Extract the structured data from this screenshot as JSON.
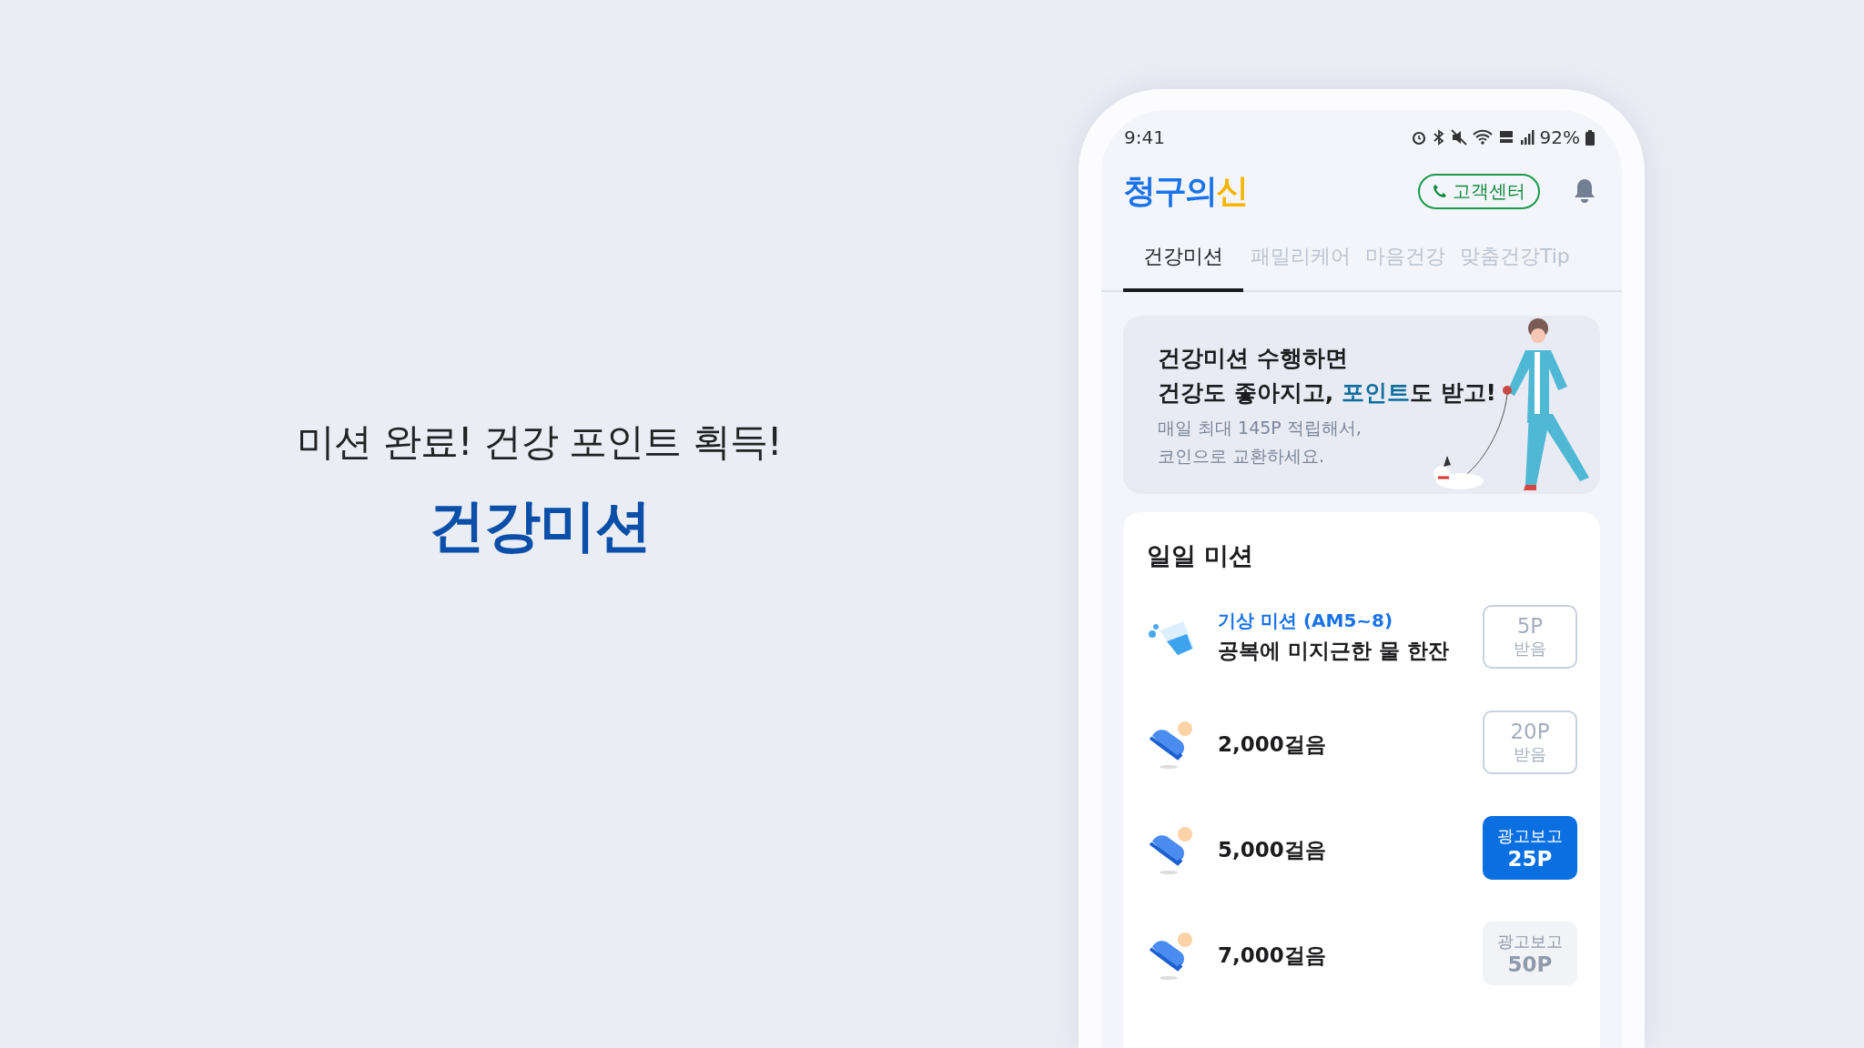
{
  "headline": {
    "subtitle": "미션 완료! 건강 포인트 획득!",
    "title": "건강미션"
  },
  "status_bar": {
    "time": "9:41",
    "battery": "92%"
  },
  "header": {
    "logo_parts": [
      {
        "text": "청구의",
        "color": "#1a73e8"
      },
      {
        "text": "신",
        "color": "#f7b500"
      }
    ],
    "support_button": "고객센터"
  },
  "tabs": [
    {
      "label": "건강미션",
      "selected": true
    },
    {
      "label": "패밀리케어",
      "selected": false
    },
    {
      "label": "마음건강",
      "selected": false
    },
    {
      "label": "맞춤건강Tip",
      "selected": false
    }
  ],
  "banner": {
    "title_line1": "건강미션 수행하면",
    "title_line2": {
      "before": "건강도 좋아지고, ",
      "highlight": "포인트",
      "after": "도 받고!"
    },
    "description": [
      "매일 최대 145P 적립해서,",
      "코인으로 교환하세요."
    ]
  },
  "missions": {
    "title": "일일 미션",
    "items": [
      {
        "kind": "water",
        "tag": "기상 미션 (AM5~8)",
        "title": "공복에 미지근한 물 한잔",
        "button": {
          "kind": "received",
          "reward": "5P",
          "action": "받음"
        }
      },
      {
        "kind": "steps",
        "title": "2,000걸음",
        "button": {
          "kind": "received",
          "reward": "20P",
          "action": "받음"
        }
      },
      {
        "kind": "steps",
        "title": "5,000걸음",
        "button": {
          "kind": "available",
          "reward": "25P",
          "action": "광고보고"
        }
      },
      {
        "kind": "steps",
        "title": "7,000걸음",
        "button": {
          "kind": "locked",
          "reward": "50P",
          "action": "광고보고"
        }
      }
    ]
  }
}
